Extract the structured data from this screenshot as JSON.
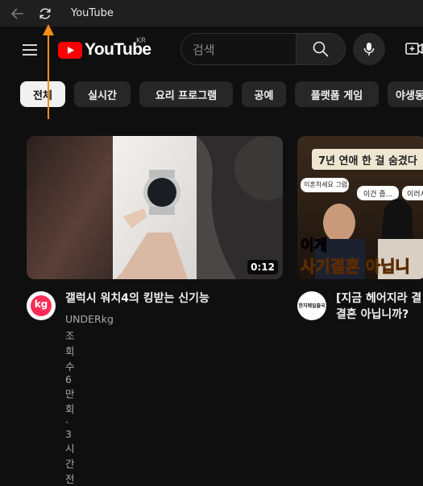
{
  "window": {
    "title": "YouTube"
  },
  "header": {
    "logo_text": "YouTube",
    "country_code": "KR",
    "search_placeholder": "검색"
  },
  "chips": [
    {
      "label": "전체",
      "active": true
    },
    {
      "label": "실시간"
    },
    {
      "label": "요리 프로그램"
    },
    {
      "label": "공예"
    },
    {
      "label": "플랫폼 게임"
    },
    {
      "label": "야생동"
    }
  ],
  "videos": [
    {
      "title": "갤럭시 워치4의 킹받는 신기능",
      "channel": "UNDERkg",
      "meta": "조회수 6만회 · 3시간 전",
      "duration": "0:12",
      "avatar_text": "kg"
    },
    {
      "title_line1": "[지금 헤어지라 결",
      "title_line2": "결혼 아닙니까?",
      "channel": "",
      "meta": "",
      "overlay_top": "7년 연애 한 걸 숨겼다",
      "overlay_bubble1": "이혼하세요 그럼...",
      "overlay_bubble2": "이건 좀...",
      "overlay_bubble3": "이러시",
      "overlay_caption1": "이게",
      "overlay_caption2": "사기결혼 아닙니",
      "avatar_text": "한지혜일출국"
    }
  ],
  "colors": {
    "accent": "#ff0000",
    "annotation": "#ff8c1a",
    "background": "#0f0f0f"
  },
  "icons": [
    "back-arrow-icon",
    "refresh-icon",
    "menu-icon",
    "search-icon",
    "mic-icon",
    "create-icon"
  ]
}
